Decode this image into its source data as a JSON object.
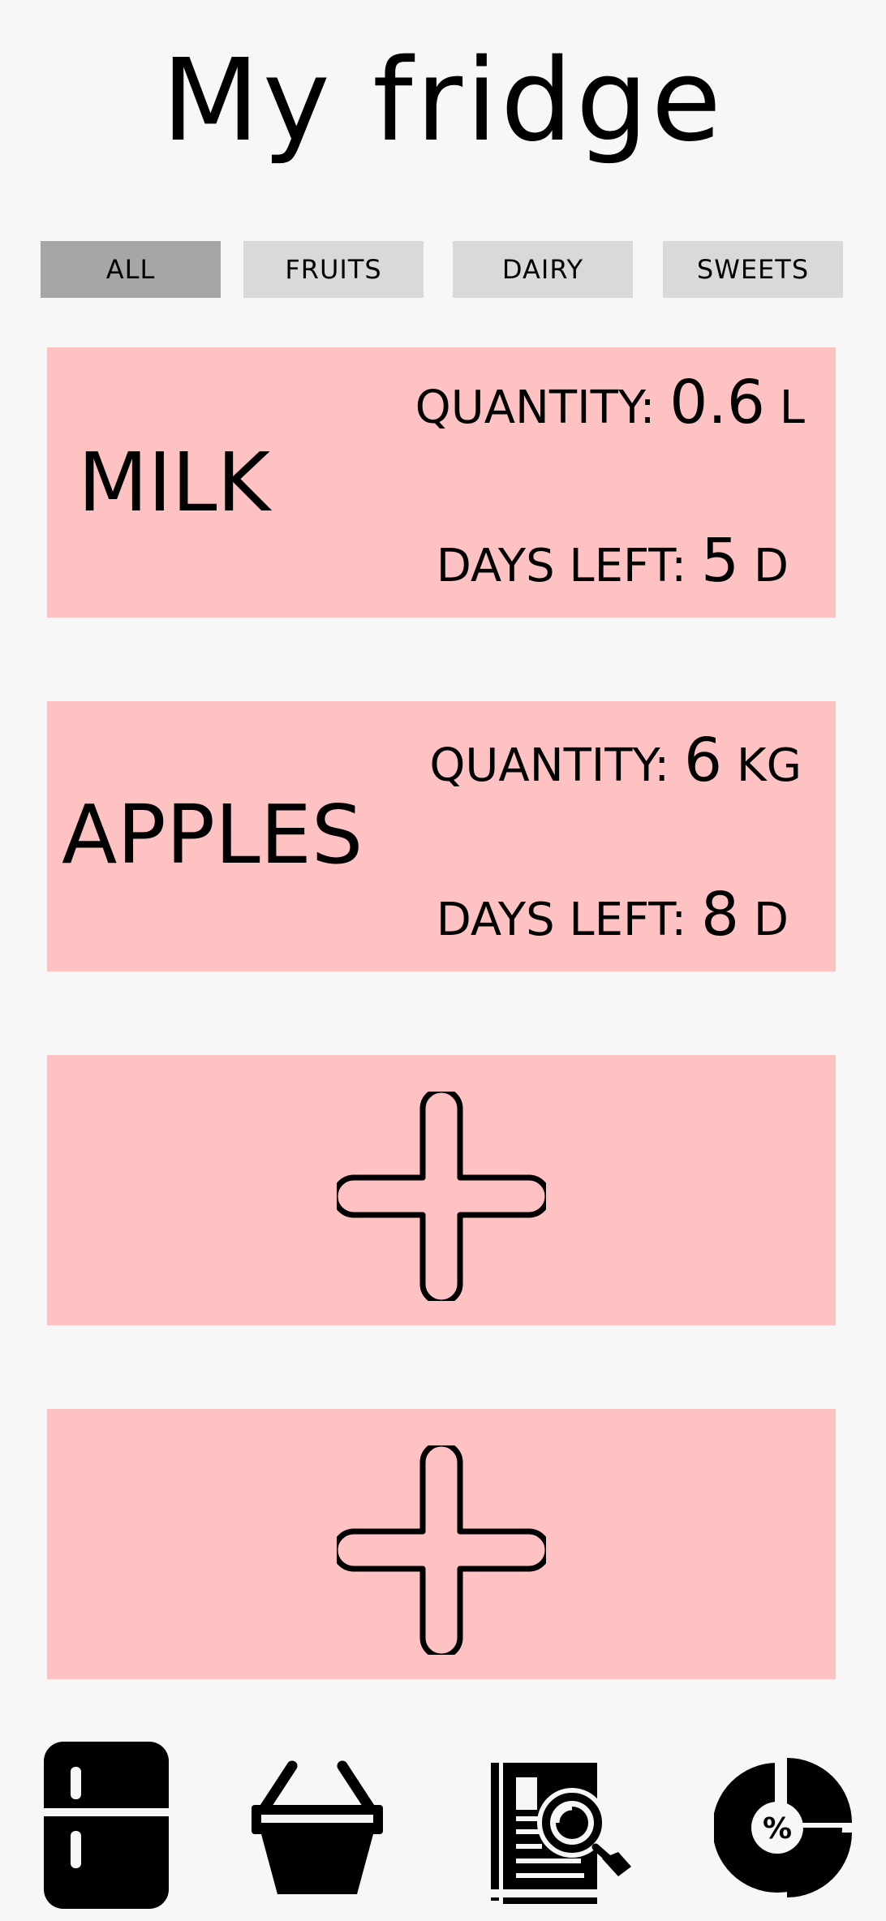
{
  "app": {
    "title": "My fridge"
  },
  "filters": {
    "tabs": [
      {
        "label": "All",
        "active": true
      },
      {
        "label": "Fruits",
        "active": false
      },
      {
        "label": "Dairy",
        "active": false
      },
      {
        "label": "Sweets",
        "active": false
      }
    ]
  },
  "items": [
    {
      "name": "Milk",
      "quantity_label": "Quantity:",
      "quantity_value": "0.6",
      "quantity_unit": "L",
      "days_label": "Days left:",
      "days_value": "5",
      "days_unit": "D"
    },
    {
      "name": "Apples",
      "quantity_label": "Quantity:",
      "quantity_value": "6",
      "quantity_unit": "kg",
      "days_label": "Days left:",
      "days_value": "8",
      "days_unit": "D"
    }
  ],
  "add_slots": [
    {
      "icon": "plus-icon"
    },
    {
      "icon": "plus-icon"
    }
  ],
  "bottom_nav": {
    "items": [
      {
        "icon": "fridge-icon"
      },
      {
        "icon": "basket-icon"
      },
      {
        "icon": "recipe-search-icon"
      },
      {
        "icon": "pie-chart-percent-icon"
      }
    ],
    "percent_symbol": "%"
  },
  "colors": {
    "background": "#f7f7f7",
    "card": "#ffc2c2",
    "tab": "#d9d9d9",
    "tab_active": "#a6a6a6",
    "ink": "#000000"
  }
}
